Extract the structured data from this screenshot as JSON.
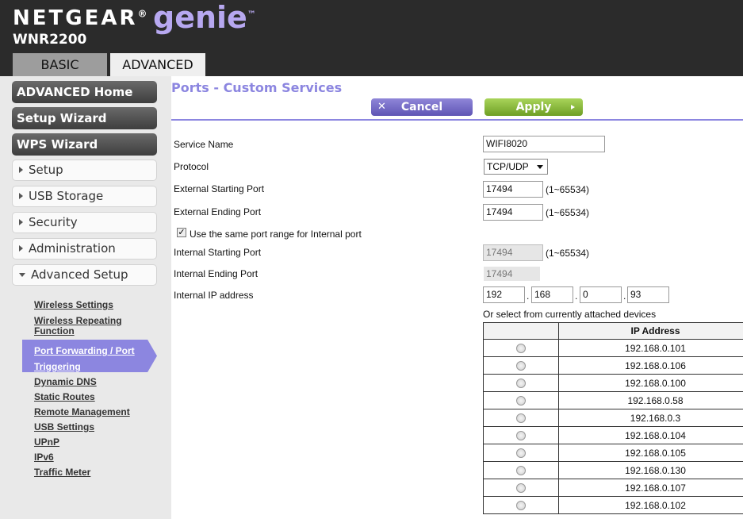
{
  "header": {
    "brand": "NETGEAR",
    "brand_mark": "®",
    "product": "genie",
    "product_mark": "™",
    "model": "WNR2200",
    "tabs": [
      {
        "label": "BASIC",
        "active": false
      },
      {
        "label": "ADVANCED",
        "active": true
      }
    ]
  },
  "sidebar": {
    "primary": [
      {
        "label": "ADVANCED Home"
      },
      {
        "label": "Setup Wizard"
      },
      {
        "label": "WPS Wizard"
      }
    ],
    "sections": [
      {
        "label": "Setup",
        "expanded": false
      },
      {
        "label": "USB Storage",
        "expanded": false
      },
      {
        "label": "Security",
        "expanded": false
      },
      {
        "label": "Administration",
        "expanded": false
      },
      {
        "label": "Advanced Setup",
        "expanded": true
      }
    ],
    "submenu": {
      "wireless_settings": "Wireless Settings",
      "wireless_repeating_1": "Wireless Repeating",
      "wireless_repeating_2": "Function",
      "port_forwarding_1": "Port Forwarding / Port",
      "port_forwarding_2": "Triggering",
      "dynamic_dns": "Dynamic DNS",
      "static_routes": "Static Routes",
      "remote_management": "Remote Management",
      "usb_settings": "USB Settings",
      "upnp": "UPnP",
      "ipv6": "IPv6",
      "traffic_meter": "Traffic Meter"
    }
  },
  "main": {
    "title": "Ports - Custom Services",
    "cancel_label": "Cancel",
    "apply_label": "Apply",
    "form": {
      "service_name_label": "Service Name",
      "service_name": "WIFI8020",
      "protocol_label": "Protocol",
      "protocol": "TCP/UDP",
      "ext_start_label": "External Starting Port",
      "ext_start": "17494",
      "ext_end_label": "External Ending Port",
      "ext_end": "17494",
      "port_range": "(1~65534)",
      "same_range_label": "Use the same port range for Internal port",
      "same_range_checked": true,
      "int_start_label": "Internal Starting Port",
      "int_start": "17494",
      "int_end_label": "Internal Ending Port",
      "int_end": "17494",
      "ip_label": "Internal IP address",
      "ip1": "192",
      "ip2": "168",
      "ip3": "0",
      "ip4": "93",
      "dot": "."
    },
    "devices": {
      "caption": "Or select from currently attached devices",
      "header": "IP Address",
      "rows": [
        "192.168.0.101",
        "192.168.0.106",
        "192.168.0.100",
        "192.168.0.58",
        "192.168.0.3",
        "192.168.0.104",
        "192.168.0.105",
        "192.168.0.130",
        "192.168.0.107",
        "192.168.0.102"
      ]
    }
  },
  "colors": {
    "header_bg": "#2b2b2b",
    "accent_purple": "#8c86e0",
    "apply_green": "#86b83b",
    "sidebar_bg": "#e9e9e9"
  }
}
